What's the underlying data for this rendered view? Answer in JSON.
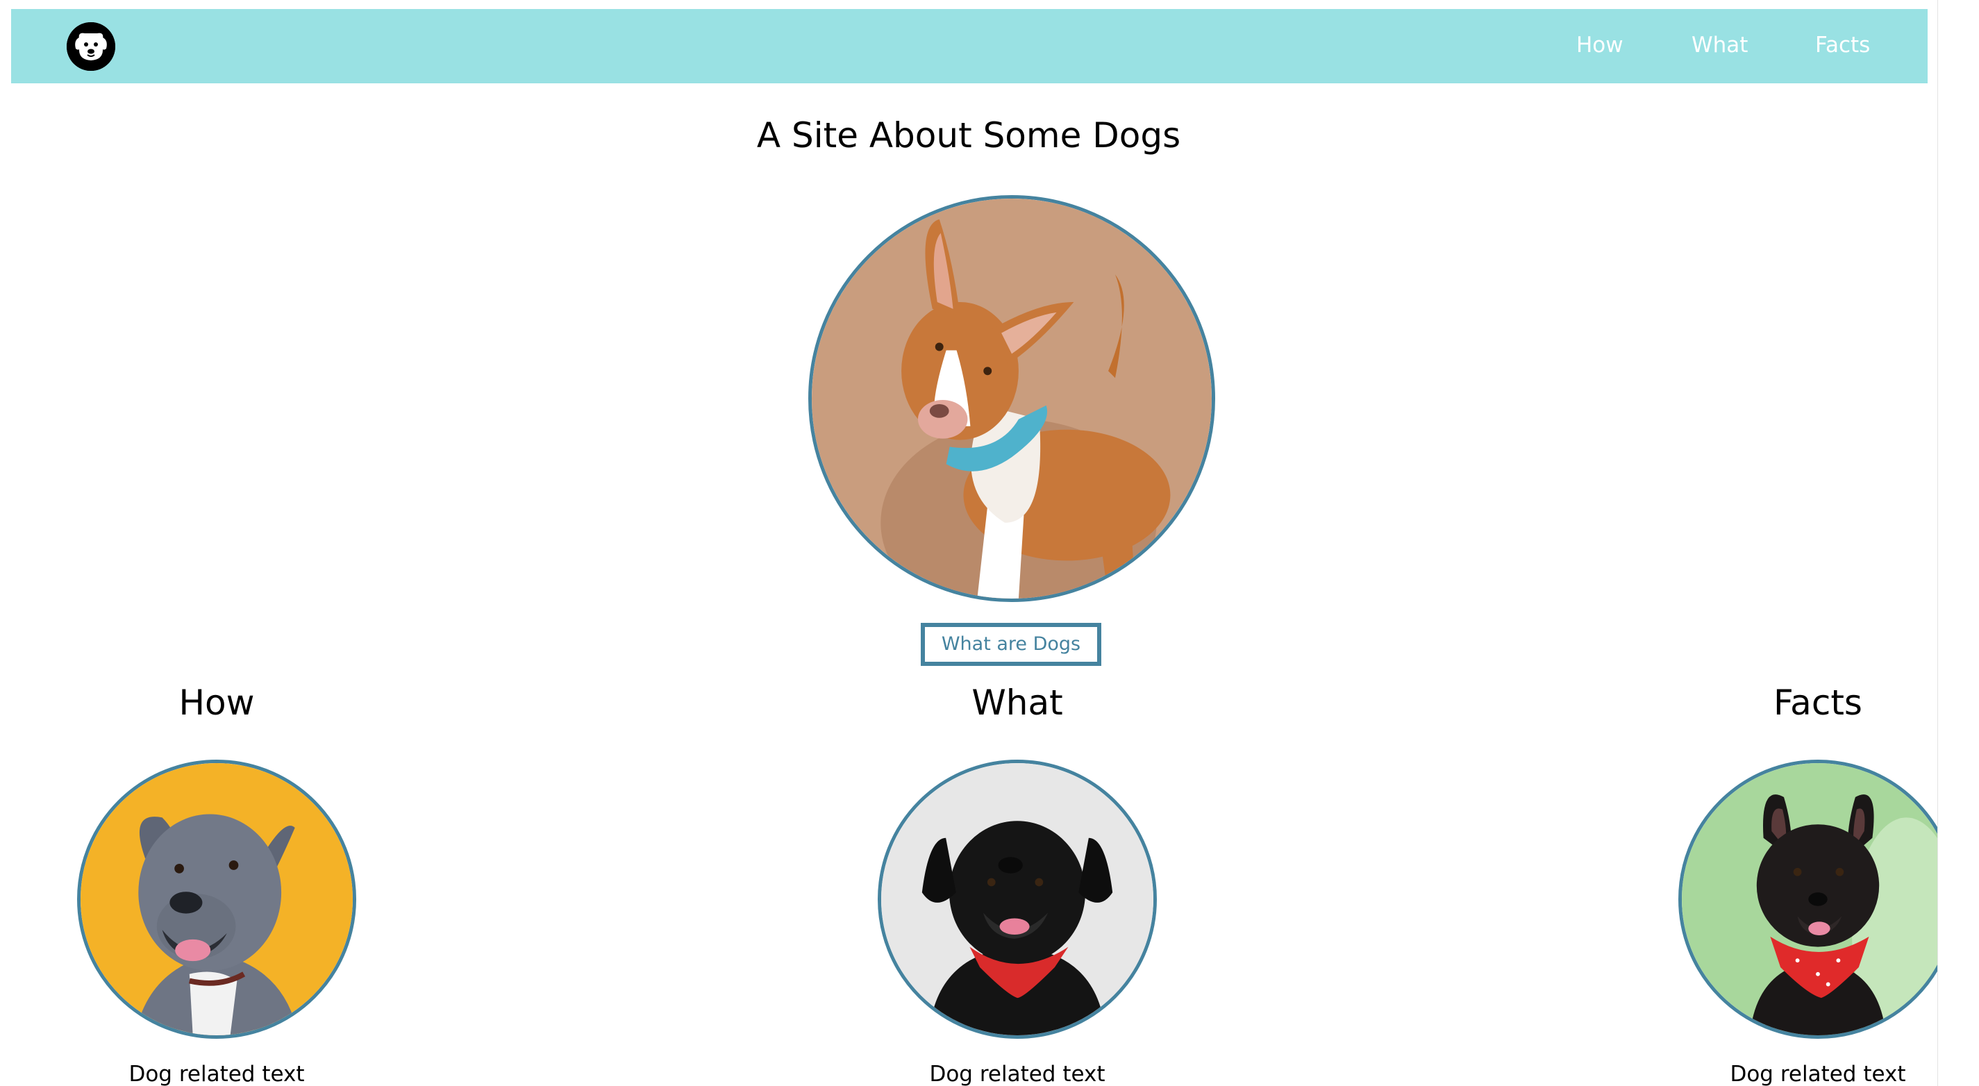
{
  "navbar": {
    "logo_icon": "dog-face-icon",
    "background_color": "#99e1e3",
    "links": [
      {
        "label": "How"
      },
      {
        "label": "What"
      },
      {
        "label": "Facts"
      }
    ]
  },
  "hero": {
    "title": "A Site About Some Dogs",
    "image": "tan-and-white-dog-with-blue-bandana",
    "button_label": "What are Dogs"
  },
  "sections": [
    {
      "heading": "How",
      "image": "grey-dog-on-yellow-background",
      "text": "Dog related text"
    },
    {
      "heading": "What",
      "image": "black-dog-with-red-bandana-on-white-background",
      "text": "Dog related text"
    },
    {
      "heading": "Facts",
      "image": "black-dog-with-red-bandana-on-green-background",
      "text": "Dog related text"
    }
  ],
  "colors": {
    "accent": "#45839f",
    "nav_text": "#ffffff",
    "page_background": "#ffffff"
  }
}
